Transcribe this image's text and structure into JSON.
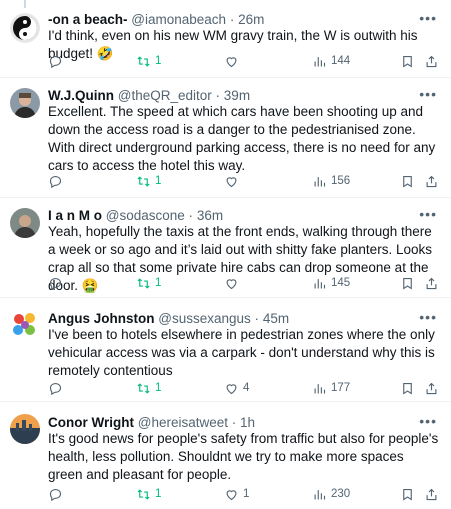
{
  "tweets": [
    {
      "name": "-on a beach-",
      "handle": "@iamonabeach",
      "dot": "·",
      "time": "26m",
      "text": "I'd think, even on his new WM gravy train, the W is outwith his budget! 🤣",
      "replies": "",
      "retweets": "1",
      "likes": "",
      "views": "144",
      "avatar_icon": "yin-yang-avatar"
    },
    {
      "name": "W.J.Quinn",
      "handle": "@theQR_editor",
      "dot": "·",
      "time": "39m",
      "text": "Excellent. The speed at which cars have been shooting up and down the access road is a danger to the pedestrianised zone. With direct underground parking access, there is no need for any cars to access the hotel this way.",
      "replies": "",
      "retweets": "1",
      "likes": "",
      "views": "156",
      "avatar_icon": "person-photo-avatar"
    },
    {
      "name": "I a n M o",
      "handle": "@sodascone",
      "dot": "·",
      "time": "36m",
      "text": "Yeah, hopefully the taxis at the front ends, walking through there a week or so ago and it’s laid out with shitty fake planters. Looks crap all so that some private hire cabs can drop someone at the door. 🤮",
      "replies": "",
      "retweets": "1",
      "likes": "",
      "views": "145",
      "avatar_icon": "person-photo-avatar"
    },
    {
      "name": "Angus Johnston",
      "handle": "@sussexangus",
      "dot": "·",
      "time": "45m",
      "text": "I've been to hotels elsewhere in pedestrian zones where the only vehicular access was via a carpark - don't understand why this is remotely contentious",
      "replies": "",
      "retweets": "1",
      "likes": "4",
      "views": "177",
      "avatar_icon": "colorful-avatar"
    },
    {
      "name": "Conor Wright",
      "handle": "@hereisatweet",
      "dot": "·",
      "time": "1h",
      "text": "It's good news for people's safety from traffic but also for people's health, less pollution. Shouldnt we try to make more spaces green and pleasant for people.",
      "replies": "",
      "retweets": "1",
      "likes": "1",
      "views": "230",
      "avatar_icon": "landscape-avatar"
    }
  ],
  "colors": {
    "text": "#0f1419",
    "muted": "#536471",
    "retweet_green": "#00ba7c",
    "divider": "#eff3f4"
  }
}
